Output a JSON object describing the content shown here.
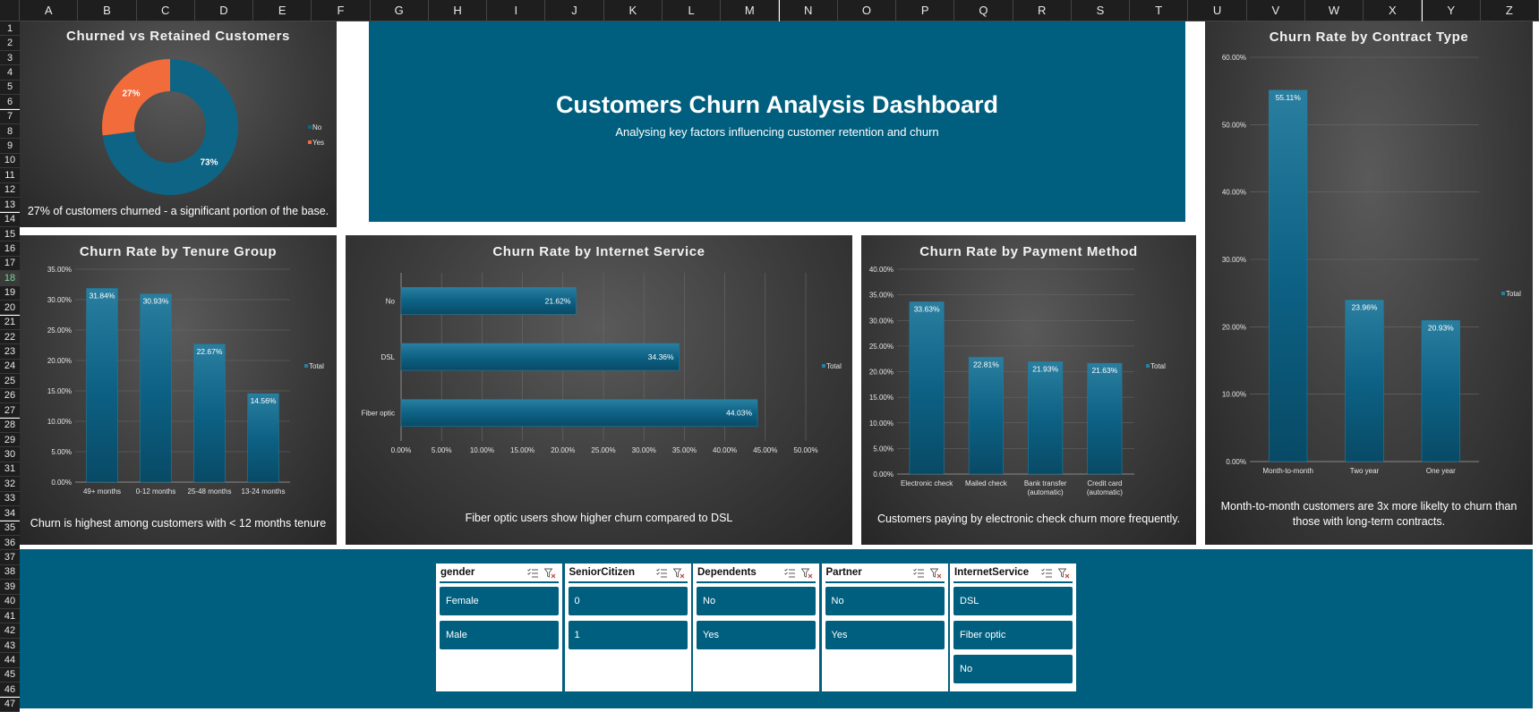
{
  "columns": [
    "A",
    "B",
    "C",
    "D",
    "E",
    "F",
    "G",
    "H",
    "I",
    "J",
    "K",
    "L",
    "M",
    "N",
    "O",
    "P",
    "Q",
    "R",
    "S",
    "T",
    "U",
    "V",
    "W",
    "X",
    "Y",
    "Z"
  ],
  "rows": [
    "1",
    "2",
    "3",
    "4",
    "5",
    "6",
    "7",
    "8",
    "9",
    "10",
    "11",
    "12",
    "13",
    "14",
    "15",
    "16",
    "17",
    "18",
    "19",
    "20",
    "21",
    "22",
    "23",
    "24",
    "25",
    "26",
    "27",
    "28",
    "29",
    "30",
    "31",
    "32",
    "33",
    "34",
    "35",
    "36",
    "37",
    "38",
    "39",
    "40",
    "41",
    "42",
    "43",
    "44",
    "45",
    "46",
    "47"
  ],
  "selected_row": "18",
  "header": {
    "title": "Customers Churn Analysis Dashboard",
    "subtitle": "Analysing key factors influencing customer retention and churn"
  },
  "colors": {
    "accent": "#005f7f",
    "bar": "#0e6485",
    "yes": "#f26b3a",
    "panel": "#3c3c3c"
  },
  "chart_data": [
    {
      "id": "churned-vs-retained",
      "type": "pie",
      "title": "Churned vs Retained Customers",
      "categories": [
        "No",
        "Yes"
      ],
      "values": [
        73,
        27
      ],
      "labels": [
        "73%",
        "27%"
      ],
      "legend": [
        "No",
        "Yes"
      ],
      "legend_position": "right",
      "caption": "27% of customers churned - a significant portion of the base."
    },
    {
      "id": "tenure-group",
      "type": "bar",
      "title": "Churn Rate by Tenure Group",
      "categories": [
        "49+ months",
        "0-12 months",
        "25-48 months",
        "13-24 months"
      ],
      "values": [
        31.84,
        30.93,
        22.67,
        14.56
      ],
      "labels": [
        "31.84%",
        "30.93%",
        "22.67%",
        "14.56%"
      ],
      "ylim": [
        0,
        35
      ],
      "yticks": [
        "0.00%",
        "5.00%",
        "10.00%",
        "15.00%",
        "20.00%",
        "25.00%",
        "30.00%",
        "35.00%"
      ],
      "legend": "Total",
      "caption": "Churn is highest among customers with < 12 months tenure"
    },
    {
      "id": "internet-service",
      "type": "bar",
      "orientation": "horizontal",
      "title": "Churn Rate by Internet Service",
      "categories": [
        "No",
        "DSL",
        "Fiber optic"
      ],
      "values": [
        21.62,
        34.36,
        44.03
      ],
      "labels": [
        "21.62%",
        "34.36%",
        "44.03%"
      ],
      "xlim": [
        0,
        50
      ],
      "xticks": [
        "0.00%",
        "5.00%",
        "10.00%",
        "15.00%",
        "20.00%",
        "25.00%",
        "30.00%",
        "35.00%",
        "40.00%",
        "45.00%",
        "50.00%"
      ],
      "legend": "Total",
      "caption": "Fiber optic users show higher churn compared to DSL"
    },
    {
      "id": "payment-method",
      "type": "bar",
      "title": "Churn Rate by Payment Method",
      "categories": [
        [
          "Electronic check"
        ],
        [
          "Mailed check"
        ],
        [
          "Bank transfer",
          "(automatic)"
        ],
        [
          "Credit card",
          "(automatic)"
        ]
      ],
      "values": [
        33.63,
        22.81,
        21.93,
        21.63
      ],
      "labels": [
        "33.63%",
        "22.81%",
        "21.93%",
        "21.63%"
      ],
      "ylim": [
        0,
        40
      ],
      "yticks": [
        "0.00%",
        "5.00%",
        "10.00%",
        "15.00%",
        "20.00%",
        "25.00%",
        "30.00%",
        "35.00%",
        "40.00%"
      ],
      "legend": "Total",
      "caption": "Customers paying by electronic check churn more frequently."
    },
    {
      "id": "contract-type",
      "type": "bar",
      "title": "Churn Rate by Contract Type",
      "categories": [
        "Month-to-month",
        "Two year",
        "One year"
      ],
      "values": [
        55.11,
        23.96,
        20.93
      ],
      "labels": [
        "55.11%",
        "23.96%",
        "20.93%"
      ],
      "ylim": [
        0,
        60
      ],
      "yticks": [
        "0.00%",
        "10.00%",
        "20.00%",
        "30.00%",
        "40.00%",
        "50.00%",
        "60.00%"
      ],
      "legend": "Total",
      "caption": [
        "Month-to-month customers are 3x more likelty to churn than",
        "those with long-term  contracts."
      ]
    }
  ],
  "slicers": [
    {
      "field": "gender",
      "items": [
        "Female",
        "Male"
      ]
    },
    {
      "field": "SeniorCitizen",
      "items": [
        "0",
        "1"
      ]
    },
    {
      "field": "Dependents",
      "items": [
        "No",
        "Yes"
      ]
    },
    {
      "field": "Partner",
      "items": [
        "No",
        "Yes"
      ]
    },
    {
      "field": "InternetService",
      "items": [
        "DSL",
        "Fiber optic",
        "No"
      ]
    }
  ]
}
